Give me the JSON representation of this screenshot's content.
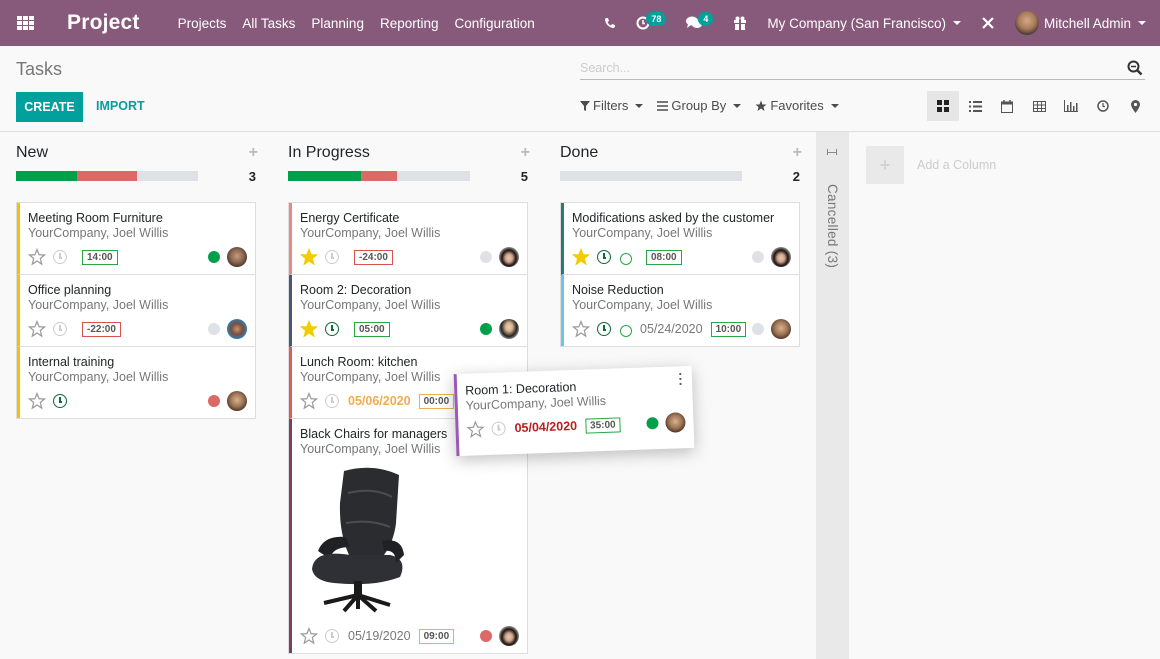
{
  "navbar": {
    "brand": "Project",
    "menu": [
      "Projects",
      "All Tasks",
      "Planning",
      "Reporting",
      "Configuration"
    ],
    "activity_badge": "78",
    "messages_badge": "4",
    "company": "My Company (San Francisco)",
    "user": "Mitchell Admin"
  },
  "control_panel": {
    "breadcrumb": "Tasks",
    "create_label": "CREATE",
    "import_label": "IMPORT",
    "search_placeholder": "Search...",
    "filters_label": "Filters",
    "groupby_label": "Group By",
    "favorites_label": "Favorites",
    "views": [
      "kanban",
      "list",
      "calendar",
      "pivot",
      "graph",
      "activity",
      "map"
    ],
    "active_view": "kanban"
  },
  "columns": [
    {
      "title": "New",
      "count": "3",
      "progress": {
        "green": 0.333,
        "red": 0.333,
        "grey": 0.334
      },
      "cards": [
        {
          "title": "Meeting Room Furniture",
          "subtitle": "YourCompany, Joel Willis",
          "starred": false,
          "activity": "none",
          "time": "14:00",
          "time_style": "g",
          "status": "green",
          "color": "#f4c20d",
          "avatar": "av1"
        },
        {
          "title": "Office planning",
          "subtitle": "YourCompany, Joel Willis",
          "starred": false,
          "activity": "none",
          "time": "-22:00",
          "time_style": "r",
          "status": "grey",
          "color": "#f4c20d",
          "avatar": "av2"
        },
        {
          "title": "Internal training",
          "subtitle": "YourCompany, Joel Willis",
          "starred": false,
          "activity": "planned",
          "status": "red",
          "color": "#f4c20d",
          "avatar": "av5"
        }
      ]
    },
    {
      "title": "In Progress",
      "count": "5",
      "progress": {
        "green": 0.4,
        "red": 0.2,
        "grey": 0.4
      },
      "cards": [
        {
          "title": "Energy Certificate",
          "subtitle": "YourCompany, Joel Willis",
          "starred": true,
          "activity": "none",
          "time": "-24:00",
          "time_style": "r",
          "status": "grey",
          "color": "#e68a8a",
          "avatar": "av3"
        },
        {
          "title": "Room 2: Decoration",
          "subtitle": "YourCompany, Joel Willis",
          "starred": true,
          "activity": "planned",
          "time": "05:00",
          "time_style": "g",
          "status": "green",
          "color": "#4a5677",
          "avatar": "av4"
        },
        {
          "title": "Lunch Room: kitchen",
          "subtitle": "YourCompany, Joel Willis",
          "starred": false,
          "activity": "none",
          "date": "05/06/2020",
          "date_style": "warn",
          "time": "00:00",
          "time_style": "o",
          "color": "#e05a5a"
        },
        {
          "title": "Black Chairs for managers",
          "subtitle": "YourCompany, Joel Willis",
          "starred": false,
          "activity": "none",
          "image": "office-chair",
          "date": "05/19/2020",
          "time": "09:00",
          "time_style": "o",
          "status": "red",
          "color": "#7b3f61",
          "avatar": "av3"
        }
      ]
    },
    {
      "title": "Done",
      "count": "2",
      "progress": {
        "green": 0,
        "red": 0,
        "grey": 1
      },
      "cards": [
        {
          "title": "Modifications asked by the customer",
          "subtitle": "YourCompany, Joel Willis",
          "starred": true,
          "activity": "planned",
          "smile": true,
          "time": "08:00",
          "time_style": "g",
          "status": "grey",
          "color": "#2a7a7a",
          "avatar": "av3"
        },
        {
          "title": "Noise Reduction",
          "subtitle": "YourCompany, Joel Willis",
          "starred": false,
          "activity": "planned",
          "smile": true,
          "date": "05/24/2020",
          "time": "10:00",
          "time_style": "g",
          "status": "grey",
          "color": "#6cc1ed",
          "avatar": "av5"
        }
      ]
    }
  ],
  "folded_column": {
    "label": "Cancelled (3)"
  },
  "add_column_label": "Add a Column",
  "dragged_card": {
    "title": "Room 1: Decoration",
    "subtitle": "YourCompany, Joel Willis",
    "starred": false,
    "date": "05/04/2020",
    "time": "35:00",
    "status": "green"
  },
  "colors": {
    "green": "#00a04a",
    "red": "#dc6965",
    "grey": "#dee2e6",
    "accent": "#00a09d",
    "brand": "#875a7b",
    "star": "#f3cc00"
  }
}
